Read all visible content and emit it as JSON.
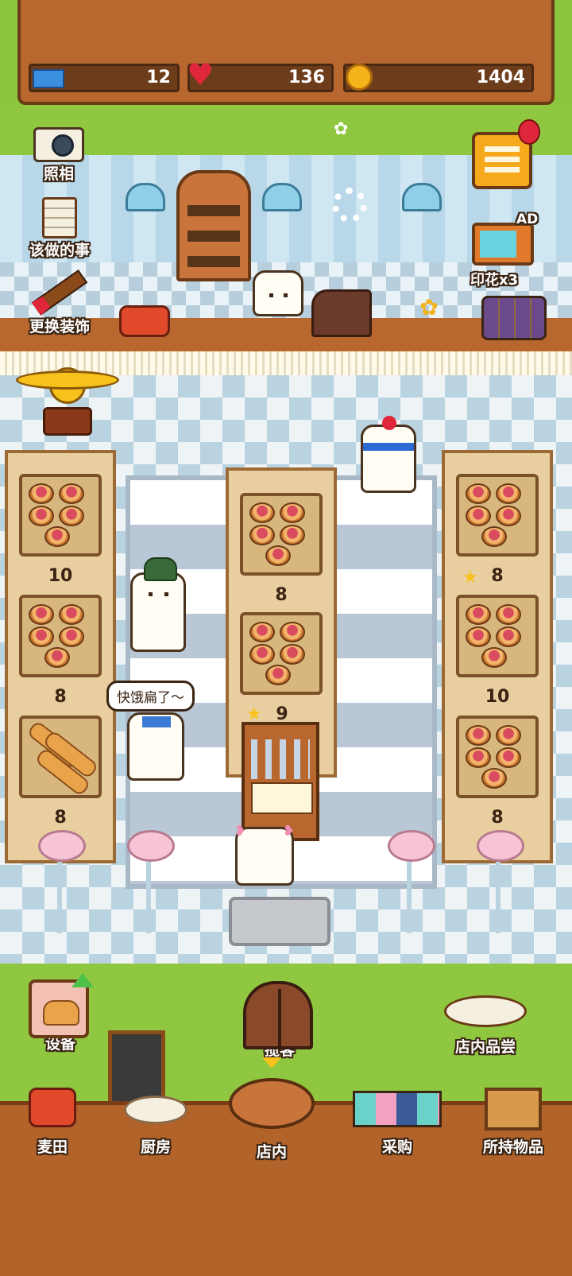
{
  "top_bar": {
    "tickets": "12",
    "hearts": "136",
    "coins": "1404"
  },
  "left_menu": {
    "photo_label": "照相",
    "todo_label": "该做的事",
    "decorate_label": "更换装饰"
  },
  "right_menu": {
    "ad_badge": "AD",
    "stamp_label": "印花x3"
  },
  "shelves": {
    "left": [
      "10",
      "8",
      "8"
    ],
    "center": [
      "8"
    ],
    "right": [
      "8",
      "10",
      "8"
    ],
    "cashier_count": "9"
  },
  "speech_bubble": "快饿扁了～",
  "actions": {
    "equipment_label": "设备",
    "attract_label": "揽客",
    "tasting_label": "店内品尝"
  },
  "bottom_nav": {
    "field": "麦田",
    "kitchen": "厨房",
    "store": "店内",
    "shopping": "采购",
    "items": "所持物品"
  },
  "colors": {
    "wood": "#b8672e",
    "grass": "#8fc740",
    "text_outline": "#3a2414"
  }
}
